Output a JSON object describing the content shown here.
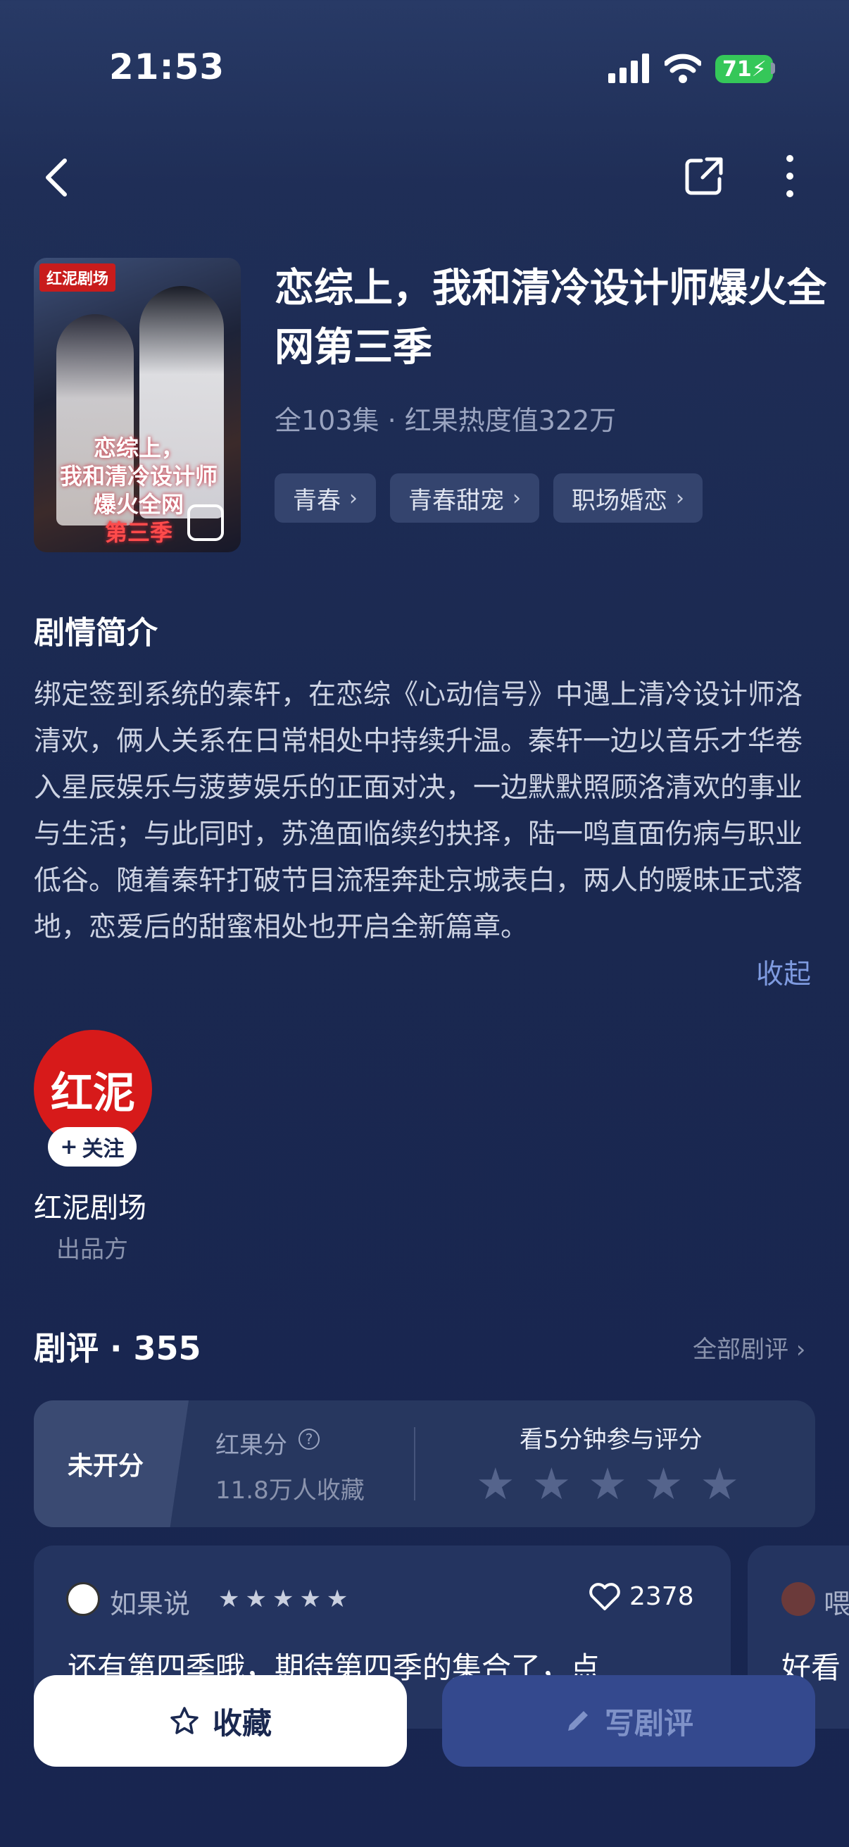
{
  "status": {
    "time": "21:53",
    "battery": "71"
  },
  "drama": {
    "title": "恋综上，我和清冷设计师爆火全网第三季",
    "meta": "全103集 · 红果热度值322万",
    "tags": [
      "青春",
      "青春甜宠",
      "职场婚恋"
    ],
    "poster": {
      "brand": "红泥剧场",
      "title_l1": "恋综上，",
      "title_l2": "我和清冷设计师",
      "title_l3": "爆火全网",
      "title_l4": "第三季"
    }
  },
  "synopsis": {
    "heading": "剧情简介",
    "text": "绑定签到系统的秦轩，在恋综《心动信号》中遇上清冷设计师洛清欢，俩人关系在日常相处中持续升温。秦轩一边以音乐才华卷入星辰娱乐与菠萝娱乐的正面对决，一边默默照顾洛清欢的事业与生活；与此同时，苏渔面临续约抉择，陆一鸣直面伤病与职业低谷。随着秦轩打破节目流程奔赴京城表白，两人的暧昧正式落地，恋爱后的甜蜜相处也开启全新篇章。",
    "collapse": "收起"
  },
  "producer": {
    "logo": "红泥",
    "follow": "关注",
    "name": "红泥剧场",
    "role": "出品方"
  },
  "reviews": {
    "heading": "剧评 · 355",
    "all": "全部剧评",
    "score": {
      "unrated": "未开分",
      "label": "红果分",
      "favorites": "11.8万人收藏",
      "cta": "看5分钟参与评分"
    },
    "items": [
      {
        "user": "如果说",
        "likes": "2378",
        "text": "还有第四季哦，期待第四季的集合了，点"
      },
      {
        "user": "喂",
        "text": "好看"
      }
    ]
  },
  "actions": {
    "favorite": "收藏",
    "write": "写剧评"
  }
}
